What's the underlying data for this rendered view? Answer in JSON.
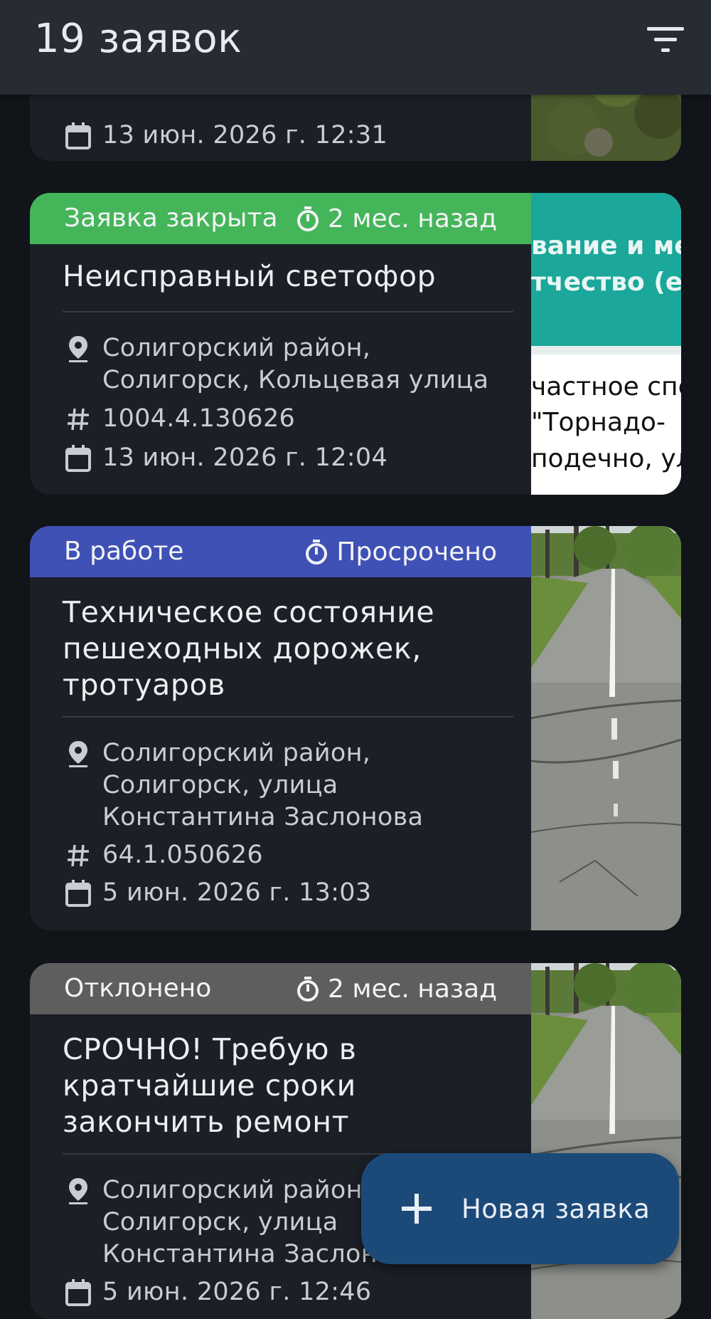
{
  "appbar": {
    "title": "19 заявок",
    "filter_icon": "filter-list-icon"
  },
  "cards": [
    {
      "date": "13 июн. 2026 г. 12:31",
      "thumb": "photo-grass"
    },
    {
      "status": "Заявка закрыта",
      "status_color": "#45b55a",
      "time": "2 мес. назад",
      "title": "Неисправный светофор",
      "address": "Солигорский район,\nСолигорск, Кольцевая улица",
      "number": "1004.4.130626",
      "date": "13 июн. 2026 г. 12:04",
      "thumb_text": {
        "line1": "вание и ме",
        "line2": "тчество (е",
        "line3": "частное спе",
        "line4": "\"Торнадо-",
        "line5": "подечно, ул"
      }
    },
    {
      "status": "В работе",
      "status_color": "#3f51b5",
      "time": "Просрочено",
      "title": "Техническое состояние пешеходных дорожек, тротуаров",
      "address": "Солигорский район,\nСолигорск, улица\nКонстантина Заслонова",
      "number": "64.1.050626",
      "date": "5 июн. 2026 г. 13:03",
      "thumb": "photo-sidewalk"
    },
    {
      "status": "Отклонено",
      "status_color": "#5e5e5e",
      "time": "2 мес. назад",
      "title": "СРОЧНО! Требую в кратчайшие сроки закончить ремонт",
      "address": "Солигорский район,\nСолигорск, улица\nКонстантина Заслонова",
      "date": "5 июн. 2026 г. 12:46",
      "thumb": "photo-sidewalk"
    }
  ],
  "fab": {
    "label": "Новая заявка",
    "icon": "plus-icon"
  }
}
